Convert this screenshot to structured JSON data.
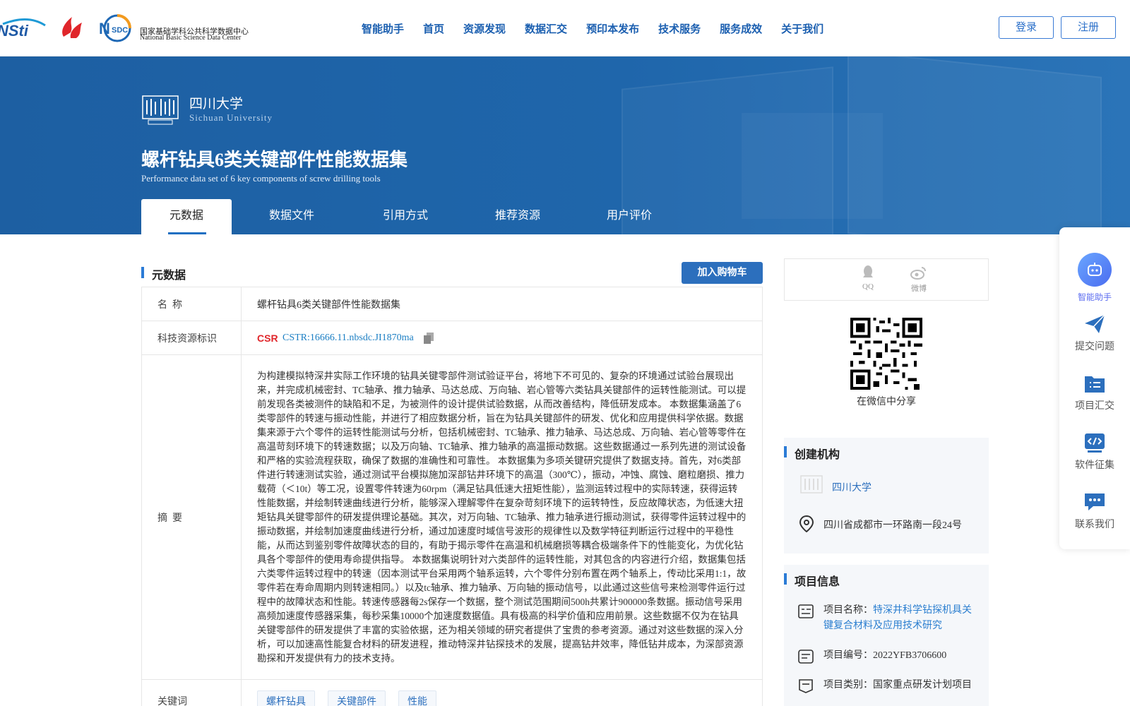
{
  "header": {
    "logo_nsdc_cn": "国家基础学科公共科学数据中心",
    "logo_nsdc_en": "National Basic Science Data Center",
    "nav": [
      "智能助手",
      "首页",
      "资源发现",
      "数据汇交",
      "预印本发布",
      "技术服务",
      "服务成效",
      "关于我们"
    ],
    "login": "登录",
    "register": "注册"
  },
  "banner": {
    "university_cn": "四川大学",
    "university_en": "Sichuan University",
    "title": "螺杆钻具6类关键部件性能数据集",
    "subtitle": "Performance data set of 6 key components of screw drilling tools",
    "tabs": [
      "元数据",
      "数据文件",
      "引用方式",
      "推荐资源",
      "用户评价"
    ],
    "active_tab": "元数据"
  },
  "metadata": {
    "section_title": "元数据",
    "cart_button": "加入购物车",
    "name_label": "名  称",
    "name_value": "螺杆钻具6类关键部件性能数据集",
    "id_label": "科技资源标识",
    "cstr": "CSTR:16666.11.nbsdc.JI1870ma",
    "abstract_label": "摘  要",
    "abstract": "为构建模拟特深井实际工作环境的钻具关键零部件测试验证平台，将地下不可见的、复杂的环境通过试验台展现出来，并完成机械密封、TC轴承、推力轴承、马达总成、万向轴、岩心管等六类钻具关键部件的运转性能测试。可以提前发现各类被测件的缺陷和不足，为被测件的设计提供试验数据，从而改善结构，降低研发成本。 本数据集涵盖了6类零部件的转速与振动性能，并进行了相应数据分析，旨在为钻具关键部件的研发、优化和应用提供科学依据。数据集来源于六个零件的运转性能测试与分析，包括机械密封、TC轴承、推力轴承、马达总成、万向轴、岩心管等零件在高温苛刻环境下的转速数据；以及万向轴、TC轴承、推力轴承的高温振动数据。这些数据通过一系列先进的测试设备和严格的实验流程获取，确保了数据的准确性和可靠性。 本数据集为多项关键研究提供了数据支持。首先，对6类部件进行转速测试实验，通过测试平台模拟施加深部钻井环境下的高温（300℃），振动，冲蚀、腐蚀、磨粒磨损、推力载荷（＜10t）等工况，设置零件转速为60rpm（满足钻具低速大扭矩性能），监测运转过程中的实际转速，获得运转性能数据，并绘制转速曲线进行分析，能够深入理解零件在复杂苛刻环境下的运转特性，反应故障状态，为低速大扭矩钻具关键零部件的研发提供理论基础。其次，对万向轴、TC轴承、推力轴承进行振动测试，获得零件运转过程中的振动数据，并绘制加速度曲线进行分析，通过加速度时域信号波形的规律性以及数学特征判断运行过程中的平稳性能，从而达到鉴别零件故障状态的目的，有助于揭示零件在高温和机械磨损等耦合极端条件下的性能变化，为优化钻具各个零部件的使用寿命提供指导。 本数据集说明针对六类部件的运转性能，对其包含的内容进行介绍，数据集包括六类零件运转过程中的转速（因本测试平台采用两个轴系运转，六个零件分别布置在两个轴系上，传动比采用1:1，故零件若在寿命周期内则转速相同。）以及tc轴承、推力轴承、万向轴的振动信号，以此通过这些信号来检测零件运行过程中的故障状态和性能。转速传感器每2s保存一个数据，整个测试范围期间500h共累计900000条数据。振动信号采用高频加速度传感器采集，每秒采集10000个加速度数据值。具有极高的科学价值和应用前景。这些数据不仅为在钻具关键零部件的研发提供了丰富的实验依据，还为相关领域的研究者提供了宝贵的参考资源。通过对这些数据的深入分析，可以加速高性能复合材料的研发进程，推动特深井钻探技术的发展，提高钻井效率，降低钻井成本，为深部资源勘探和开发提供有力的技术支持。",
    "keywords_label": "关键词",
    "keywords": [
      "螺杆钻具",
      "关键部件",
      "性能"
    ]
  },
  "share": {
    "qq": "QQ",
    "weibo": "微博",
    "wechat_label": "在微信中分享"
  },
  "org": {
    "title": "创建机构",
    "name": "四川大学",
    "address": "四川省成都市一环路南一段24号"
  },
  "project": {
    "title": "项目信息",
    "name_prefix": "项目名称：",
    "name_link": "特深井科学钻探机具关键复合材料及应用技术研究",
    "number": "项目编号：2022YFB3706600",
    "category": "项目类别：国家重点研发计划项目"
  },
  "float_bar": {
    "assistant": "智能助手",
    "submit_issue": "提交问题",
    "project_submit": "项目汇交",
    "software": "软件征集",
    "contact": "联系我们"
  },
  "colors": {
    "brand_blue": "#1d5fa2",
    "link_blue": "#2c6fbd"
  }
}
